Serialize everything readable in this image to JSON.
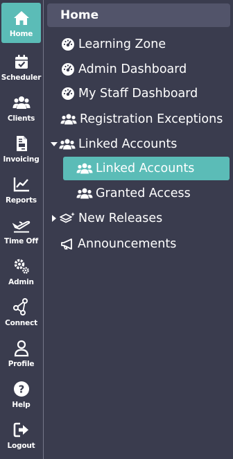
{
  "rail": {
    "items": [
      {
        "label": "Home",
        "icon": "home-icon",
        "active": true
      },
      {
        "label": "Scheduler",
        "icon": "calendar-check-icon"
      },
      {
        "label": "Clients",
        "icon": "users-icon"
      },
      {
        "label": "Invoicing",
        "icon": "invoice-icon"
      },
      {
        "label": "Reports",
        "icon": "chart-line-icon"
      },
      {
        "label": "Time Off",
        "icon": "plane-icon"
      },
      {
        "label": "Admin",
        "icon": "gears-icon"
      },
      {
        "label": "Connect",
        "icon": "network-icon"
      },
      {
        "label": "Profile",
        "icon": "user-icon"
      },
      {
        "label": "Help",
        "icon": "question-circle-icon"
      },
      {
        "label": "Logout",
        "icon": "logout-icon"
      }
    ]
  },
  "menu": {
    "header": "Home",
    "items": [
      {
        "label": "Learning Zone",
        "icon": "dashboard-gauge-icon"
      },
      {
        "label": "Admin Dashboard",
        "icon": "dashboard-gauge-icon"
      },
      {
        "label": "My Staff Dashboard",
        "icon": "dashboard-gauge-icon"
      },
      {
        "label": "Registration Exceptions",
        "icon": "users-icon"
      },
      {
        "label": "Linked Accounts",
        "icon": "users-icon",
        "expanded": true
      },
      {
        "label": "Linked Accounts",
        "icon": "users-icon",
        "selected": true
      },
      {
        "label": "Granted Access",
        "icon": "users-icon"
      },
      {
        "label": "New Releases",
        "icon": "layers-sparkle-icon",
        "expanded": false
      },
      {
        "label": "Announcements",
        "icon": "megaphone-icon"
      }
    ]
  },
  "colors": {
    "background": "#3a3c4e",
    "accent": "#5bbcb7",
    "header": "#52546a",
    "divider": "#76788a"
  }
}
